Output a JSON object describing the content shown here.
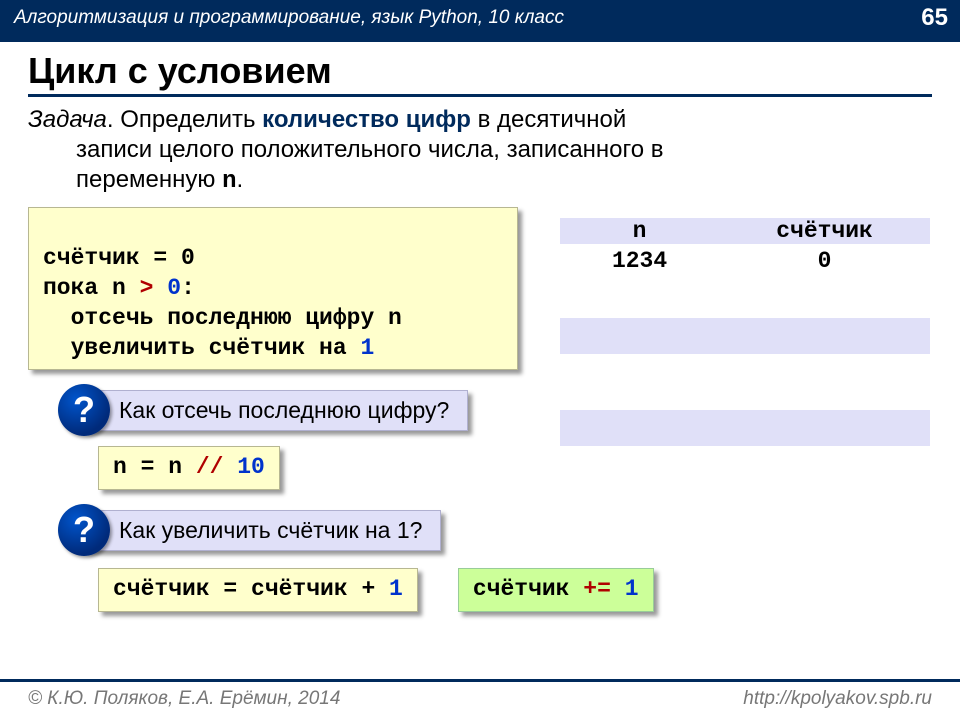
{
  "header": {
    "course": "Алгоритмизация и программирование, язык Python, 10 класс",
    "page": "65"
  },
  "title": "Цикл с условием",
  "task": {
    "label": "Задача",
    "line1a": ". Определить ",
    "bold": "количество цифр",
    "line1b": " в десятичной",
    "line2": "записи целого положительного числа, записанного в",
    "line3_pre": "переменную ",
    "var": "n",
    "line3_post": "."
  },
  "pseudocode": {
    "l1": "счётчик = 0",
    "l2a": "пока n ",
    "l2op": ">",
    "l2b": " ",
    "l2num": "0",
    "l2c": ":",
    "l3": "  отсечь последнюю цифру n",
    "l4a": "  увеличить счётчик на ",
    "l4num": "1"
  },
  "table": {
    "h1": "n",
    "h2": "счётчик",
    "r1c1": "1234",
    "r1c2": "0"
  },
  "q1": {
    "mark": "?",
    "text": "Как отсечь последнюю цифру?"
  },
  "code1": {
    "a": "n = n ",
    "op": "//",
    "b": " ",
    "num": "10"
  },
  "q2": {
    "mark": "?",
    "text": "Как увеличить счётчик на 1?"
  },
  "code2": {
    "a": "счётчик = счётчик + ",
    "num": "1"
  },
  "code3": {
    "a": "счётчик ",
    "op": "+=",
    "b": " ",
    "num": "1"
  },
  "footer": {
    "left": "© К.Ю. Поляков, Е.А. Ерёмин, 2014",
    "right": "http://kpolyakov.spb.ru"
  }
}
